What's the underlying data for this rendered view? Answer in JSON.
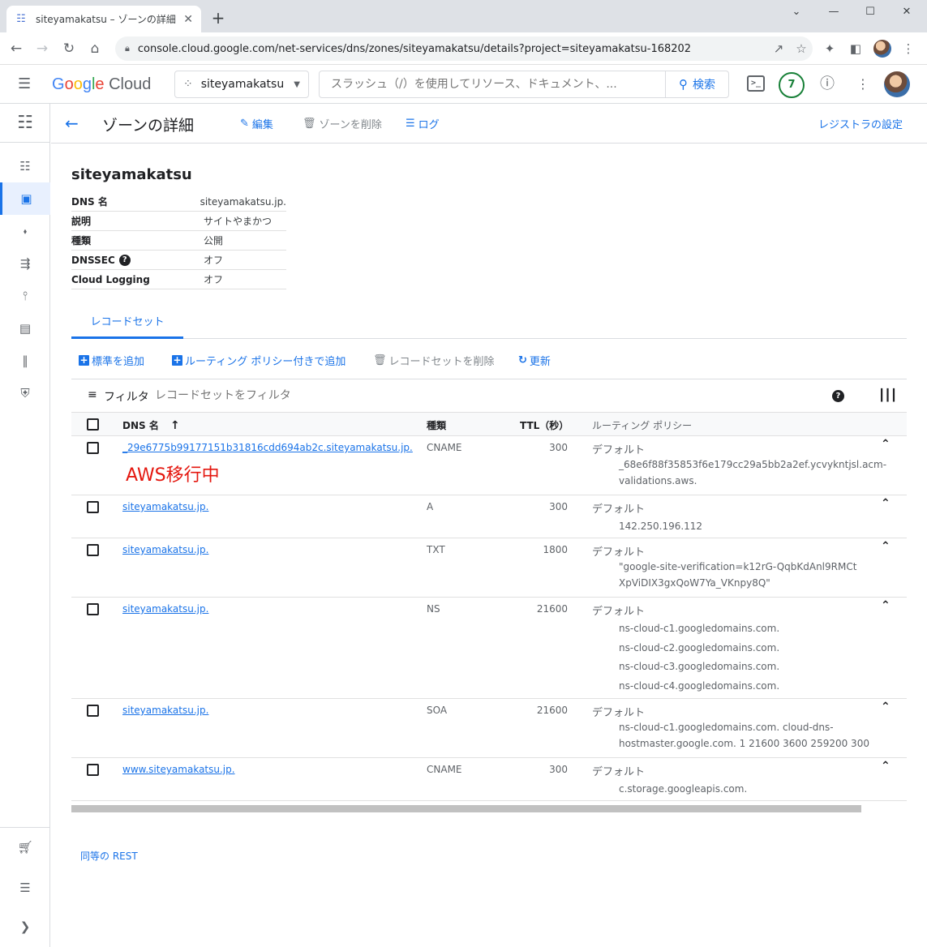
{
  "browser": {
    "tab_title": "siteyamakatsu – ゾーンの詳細 – ネッ",
    "tab_close": "✕",
    "new_tab": "+",
    "window_controls": [
      "⌄",
      "—",
      "☐",
      "✕"
    ],
    "url": "console.cloud.google.com/net-services/dns/zones/siteyamakatsu/details?project=siteyamakatsu-168202"
  },
  "header": {
    "logo_parts": [
      "G",
      "o",
      "o",
      "g",
      "l",
      "e"
    ],
    "logo_cloud": " Cloud",
    "project": "siteyamakatsu",
    "search_placeholder": "スラッシュ（/）を使用してリソース、ドキュメント、...",
    "search_button": "検索",
    "cloud_shell": ">_",
    "notifications": "7"
  },
  "page": {
    "title": "ゾーンの詳細",
    "actions": {
      "edit": "編集",
      "delete_zone": "ゾーンを削除",
      "log": "ログ"
    },
    "registrar": "レジストラの設定"
  },
  "zone": {
    "name": "siteyamakatsu",
    "details": [
      {
        "key": "DNS 名",
        "value": "siteyamakatsu.jp."
      },
      {
        "key": "説明",
        "value": "サイトやまかつ"
      },
      {
        "key": "種類",
        "value": "公開"
      },
      {
        "key": "DNSSEC",
        "value": "オフ"
      },
      {
        "key": "Cloud Logging",
        "value": "オフ"
      }
    ]
  },
  "tabs": {
    "record_sets": "レコードセット"
  },
  "record_actions": {
    "add_standard": "標準を追加",
    "add_routing": "ルーティング ポリシー付きで追加",
    "delete_records": "レコードセットを削除",
    "refresh": "更新"
  },
  "filter": {
    "label": "フィルタ",
    "placeholder": "レコードセットをフィルタ"
  },
  "table": {
    "columns": {
      "dns_name": "DNS 名",
      "sort": "↑",
      "type": "種類",
      "ttl": "TTL（秒）",
      "routing": "ルーティング ポリシー"
    },
    "rows": [
      {
        "name": "_29e6775b99177151b31816cdd694ab2c.siteyamakatsu.jp.",
        "type": "CNAME",
        "ttl": "300",
        "policy": "デフォルト",
        "data": "_68e6f88f35853f6e179cc29a5bb2a2ef.ycvykntjsl.acm-validations.aws.",
        "annotation": "AWS移行中"
      },
      {
        "name": "siteyamakatsu.jp.",
        "type": "A",
        "ttl": "300",
        "policy": "デフォルト",
        "data": "142.250.196.112"
      },
      {
        "name": "siteyamakatsu.jp.",
        "type": "TXT",
        "ttl": "1800",
        "policy": "デフォルト",
        "data": "\"google-site-verification=k12rG-QqbKdAnl9RMCtXpViDIX3gxQoW7Ya_VKnpy8Q\""
      },
      {
        "name": "siteyamakatsu.jp.",
        "type": "NS",
        "ttl": "21600",
        "policy": "デフォルト",
        "data": "ns-cloud-c1.googledomains.com.\nns-cloud-c2.googledomains.com.\nns-cloud-c3.googledomains.com.\nns-cloud-c4.googledomains.com."
      },
      {
        "name": "siteyamakatsu.jp.",
        "type": "SOA",
        "ttl": "21600",
        "policy": "デフォルト",
        "data": "ns-cloud-c1.googledomains.com. cloud-dns-hostmaster.google.com. 1 21600 3600 259200 300"
      },
      {
        "name": "www.siteyamakatsu.jp.",
        "type": "CNAME",
        "ttl": "300",
        "policy": "デフォルト",
        "data": "c.storage.googleapis.com."
      }
    ]
  },
  "footer": {
    "rest_link": "同等の REST"
  },
  "colors": {
    "accent": "#1a73e8",
    "annotation": "#e4170f",
    "active_nav": "#e8f0fe"
  }
}
